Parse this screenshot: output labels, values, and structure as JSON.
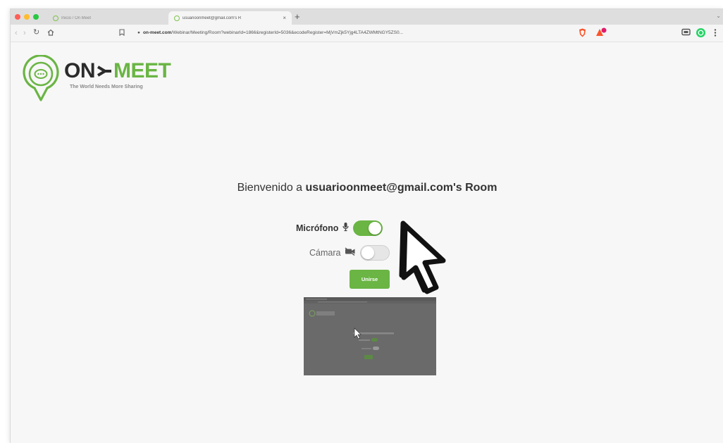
{
  "browser": {
    "tabs": [
      {
        "title": "Inicio / On Meet",
        "active": false
      },
      {
        "title": "usuarioonmeet@gmail.com's R",
        "active": true
      }
    ],
    "new_tab_symbol": "+",
    "close_symbol": "×",
    "address": {
      "domain": "on-meet.com",
      "path": "/Webinar/Meeting/Room?webinarId=1866&registerId=5036&ecodeRegister=MjVmZjk5Yjg4LTA4ZWMtNGY5ZS0..."
    },
    "traffic_lights": [
      "#ff5f57",
      "#febc2e",
      "#28c840"
    ],
    "icons": [
      "back-icon",
      "forward-icon",
      "reload-icon",
      "home-icon",
      "bookmark-icon",
      "lock-icon",
      "brave-shield-icon",
      "brave-rewards-icon",
      "cast-icon",
      "extension-whatsapp-icon",
      "menu-icon"
    ]
  },
  "brand": {
    "name_part1": "ON",
    "name_part2": "MEET",
    "tagline": "The World Needs More Sharing",
    "colors": {
      "green": "#6ab544",
      "dark": "#2b2b2b"
    }
  },
  "room": {
    "welcome_prefix": "Bienvenido a ",
    "room_name": "usuarioonmeet@gmail.com's Room",
    "microphone_label": "Micrófono",
    "microphone_on": true,
    "camera_label": "Cámara",
    "camera_on": false,
    "join_label": "Unirse"
  },
  "accent": "#6ab544"
}
